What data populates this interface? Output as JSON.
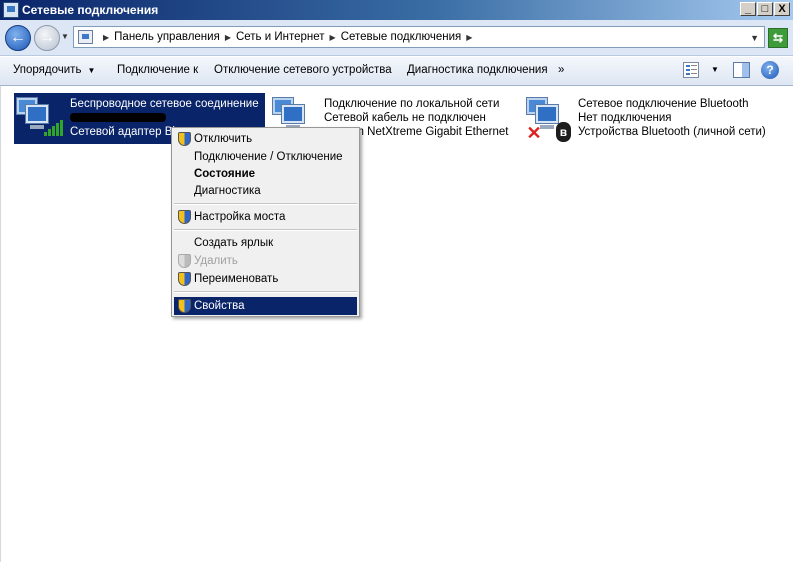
{
  "window": {
    "title": "Сетевые подключения"
  },
  "title_buttons": [
    "_",
    "□",
    "X"
  ],
  "address": {
    "crumbs": [
      "Панель управления",
      "Сеть и Интернет",
      "Сетевые подключения"
    ]
  },
  "commands": {
    "organize": "Упорядочить",
    "connect_to": "Подключение к",
    "disable_device": "Отключение сетевого устройства",
    "diagnose": "Диагностика подключения",
    "more": "»"
  },
  "connections": [
    {
      "name": "Беспроводное сетевое соединение",
      "status": "",
      "device": "Сетевой адаптер Bl",
      "selected": true,
      "icon": "wireless-network-icon"
    },
    {
      "name": "Подключение по локальной сети",
      "status": "Сетевой кабель не подключен",
      "device": "om NetXtreme Gigabit Ethernet",
      "selected": false,
      "icon": "wired-network-icon"
    },
    {
      "name": "Сетевое подключение Bluetooth",
      "status": "Нет подключения",
      "device": "Устройства Bluetooth (личной сети)",
      "selected": false,
      "icon": "bluetooth-network-icon"
    }
  ],
  "context_menu": {
    "disable": "Отключить",
    "connect_disconnect": "Подключение / Отключение",
    "status": "Состояние",
    "diagnose": "Диагностика",
    "bridge": "Настройка моста",
    "shortcut": "Создать ярлык",
    "delete": "Удалить",
    "rename": "Переименовать",
    "properties": "Свойства"
  },
  "colors": {
    "selection": "#0a246a",
    "titlebar": "#0a246a",
    "signal": "#2fa52c"
  }
}
